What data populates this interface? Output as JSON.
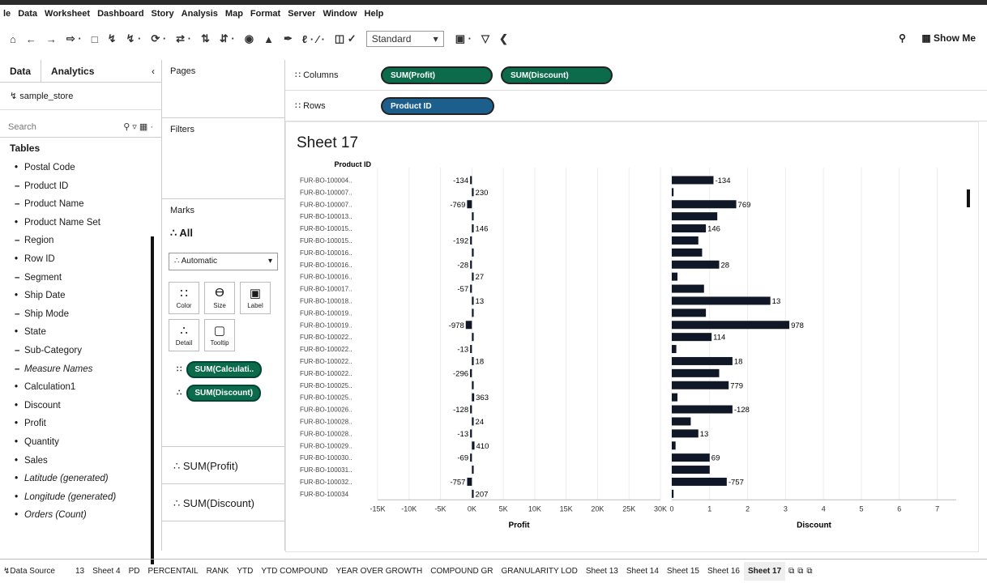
{
  "menu": [
    "le",
    "Data",
    "Worksheet",
    "Dashboard",
    "Story",
    "Analysis",
    "Map",
    "Format",
    "Server",
    "Window",
    "Help"
  ],
  "toolbar": {
    "icons": [
      "tableau-logo-icon",
      "undo-icon",
      "redo-icon",
      "redo2-icon",
      "save-icon",
      "new-datasource-icon",
      "new-worksheet-icon",
      "refresh-icon",
      "swap-icon",
      "sort-asc-icon",
      "sort-desc-icon",
      "group-icon",
      "label-icon",
      "highlight-icon",
      "fit-icon",
      "presentation-icon",
      "share-icon"
    ],
    "fit_value": "Standard",
    "show_me": "Show Me"
  },
  "data_pane": {
    "tabs": [
      "Data",
      "Analytics"
    ],
    "datasource": "sample_store",
    "search_placeholder": "Search",
    "tables_header": "Tables",
    "fields": [
      {
        "glyph": "•",
        "name": "Postal Code"
      },
      {
        "glyph": "–",
        "name": "Product ID"
      },
      {
        "glyph": "–",
        "name": "Product Name"
      },
      {
        "glyph": "•",
        "name": "Product Name Set"
      },
      {
        "glyph": "–",
        "name": "Region"
      },
      {
        "glyph": "•",
        "name": "Row ID"
      },
      {
        "glyph": "–",
        "name": "Segment"
      },
      {
        "glyph": "•",
        "name": "Ship Date"
      },
      {
        "glyph": "–",
        "name": "Ship Mode"
      },
      {
        "glyph": "•",
        "name": "State"
      },
      {
        "glyph": "–",
        "name": "Sub-Category"
      },
      {
        "glyph": "–",
        "name": "Measure Names",
        "italic": true
      },
      {
        "glyph": "•",
        "name": "Calculation1"
      },
      {
        "glyph": "•",
        "name": "Discount"
      },
      {
        "glyph": "•",
        "name": "Profit"
      },
      {
        "glyph": "•",
        "name": "Quantity"
      },
      {
        "glyph": "•",
        "name": "Sales"
      },
      {
        "glyph": "•",
        "name": "Latitude (generated)",
        "italic": true
      },
      {
        "glyph": "•",
        "name": "Longitude (generated)",
        "italic": true
      },
      {
        "glyph": "•",
        "name": "Orders (Count)",
        "italic": true
      }
    ]
  },
  "shelves": {
    "pages": "Pages",
    "filters": "Filters",
    "marks": "Marks",
    "all": "All",
    "mark_type": "Automatic",
    "mark_buttons": [
      {
        "icon": "color-icon",
        "symbol": "∷",
        "label": "Color"
      },
      {
        "icon": "size-icon",
        "symbol": "ϴ",
        "label": "Size"
      },
      {
        "icon": "label-icon",
        "symbol": "▣",
        "label": "Label"
      },
      {
        "icon": "detail-icon",
        "symbol": "∴",
        "label": "Detail"
      },
      {
        "icon": "tooltip-icon",
        "symbol": "▢",
        "label": "Tooltip"
      }
    ],
    "mark_pills": [
      "SUM(Calculati..",
      "SUM(Discount)"
    ],
    "measure_cards": [
      "SUM(Profit)",
      "SUM(Discount)"
    ],
    "columns_label": "Columns",
    "rows_label": "Rows",
    "columns_pills": [
      "SUM(Profit)",
      "SUM(Discount)"
    ],
    "rows_pills": [
      "Product ID"
    ]
  },
  "sheet_title": "Sheet 17",
  "chart_data": {
    "type": "bar",
    "row_header": "Product ID",
    "categories": [
      "FUR-BO-100004..",
      "FUR-BO-100007..",
      "FUR-BO-100007..",
      "FUR-BO-100013..",
      "FUR-BO-100015..",
      "FUR-BO-100015..",
      "FUR-BO-100016..",
      "FUR-BO-100016..",
      "FUR-BO-100016..",
      "FUR-BO-100017..",
      "FUR-BO-100018..",
      "FUR-BO-100019..",
      "FUR-BO-100019..",
      "FUR-BO-100022..",
      "FUR-BO-100022..",
      "FUR-BO-100022..",
      "FUR-BO-100022..",
      "FUR-BO-100025..",
      "FUR-BO-100025..",
      "FUR-BO-100026..",
      "FUR-BO-100028..",
      "FUR-BO-100028..",
      "FUR-BO-100029..",
      "FUR-BO-100030..",
      "FUR-BO-100031..",
      "FUR-BO-100032..",
      "FUR-BO-100034"
    ],
    "series": [
      {
        "name": "Profit",
        "values": [
          -134,
          230,
          -769,
          10,
          146,
          -192,
          8,
          -28,
          27,
          -57,
          13,
          6,
          -978,
          12,
          -13,
          18,
          -296,
          30,
          363,
          -128,
          24,
          -13,
          410,
          -69,
          5,
          -757,
          207
        ],
        "labels": [
          "-134",
          "230",
          "-769",
          "",
          "146",
          "-192",
          "",
          "-28",
          "27",
          "-57",
          "13",
          "",
          "-978",
          "",
          "-13",
          "18",
          "-296",
          "",
          "363",
          "-128",
          "24",
          "-13",
          "410",
          "-69",
          "",
          "-757",
          "207"
        ],
        "xlim": [
          -15000,
          30000
        ],
        "ticks": [
          "-15K",
          "-10K",
          "-5K",
          "0K",
          "5K",
          "10K",
          "15K",
          "20K",
          "25K",
          "30K"
        ],
        "xlabel": "Profit"
      },
      {
        "name": "Discount",
        "values": [
          1.1,
          0,
          1.7,
          1.2,
          0.9,
          0.7,
          0.8,
          1.25,
          0.15,
          0.85,
          2.6,
          0.9,
          3.1,
          1.05,
          0.12,
          1.6,
          1.25,
          1.5,
          0.15,
          1.6,
          0.5,
          0.7,
          0.1,
          1.0,
          1.0,
          1.45,
          0
        ],
        "labels": [
          "-134",
          "",
          "769",
          "",
          "146",
          "",
          "",
          "28",
          "",
          "",
          "13",
          "",
          "978",
          "114",
          "",
          "18",
          "",
          "779",
          "",
          "-128",
          "",
          "13",
          "",
          "69",
          "",
          "-757",
          ""
        ],
        "xlim": [
          0,
          7.5
        ],
        "ticks": [
          "0",
          "1",
          "2",
          "3",
          "4",
          "5",
          "6",
          "7"
        ],
        "xlabel": "Discount"
      }
    ],
    "grid": true
  },
  "sheet_tabs": {
    "datasource": "Data Source",
    "tabs": [
      "13",
      "Sheet 4",
      "PD",
      "PERCENTAIL",
      "RANK",
      "YTD",
      "YTD COMPOUND",
      "YEAR OVER GROWTH",
      "COMPOUND GR",
      "GRANULARITY LOD",
      "Sheet 13",
      "Sheet 14",
      "Sheet 15",
      "Sheet 16",
      "Sheet 17"
    ],
    "active": "Sheet 17"
  }
}
